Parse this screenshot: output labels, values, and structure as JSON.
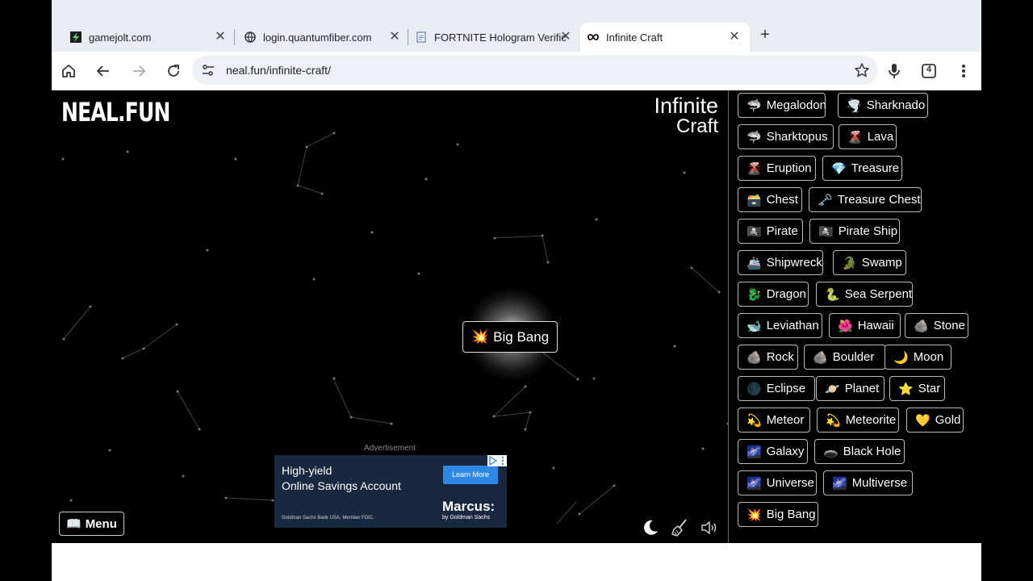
{
  "tabs": [
    {
      "title": "gamejolt.com",
      "favicon": "gamejolt-icon",
      "active": false
    },
    {
      "title": "login.quantumfiber.com",
      "favicon": "globe-icon",
      "active": false
    },
    {
      "title": "FORTNITE Hologram Verific",
      "favicon": "document-icon",
      "active": false
    },
    {
      "title": "Infinite Craft",
      "favicon": "infinity-icon",
      "active": true
    }
  ],
  "toolbar": {
    "url": "neal.fun/infinite-craft/",
    "extensions_count": "4"
  },
  "game": {
    "logo": "NEAL.FUN",
    "title_line1": "Infinite",
    "title_line2": "Craft",
    "canvas_element": {
      "emoji": "💥",
      "label": "Big Bang"
    },
    "menu_label": "Menu",
    "menu_emoji": "📖"
  },
  "ad": {
    "label": "Advertisement",
    "headline_line1": "High-yield",
    "headline_line2": "Online Savings Account",
    "cta": "Learn More",
    "brand": "Marcus:",
    "brand_sub": "by Goldman Sachs",
    "legal": "Goldman Sachs Bank USA. Member FDIC."
  },
  "sidebar": {
    "items": [
      {
        "emoji": "🦈",
        "label": "Megalodon"
      },
      {
        "emoji": "🌪️",
        "label": "Sharknado"
      },
      {
        "emoji": "🦈",
        "label": "Sharktopus"
      },
      {
        "emoji": "🌋",
        "label": "Lava"
      },
      {
        "emoji": "🌋",
        "label": "Eruption"
      },
      {
        "emoji": "💎",
        "label": "Treasure"
      },
      {
        "emoji": "🗃️",
        "label": "Chest"
      },
      {
        "emoji": "🗝️",
        "label": "Treasure Chest"
      },
      {
        "emoji": "🏴‍☠️",
        "label": "Pirate"
      },
      {
        "emoji": "🏴‍☠️",
        "label": "Pirate Ship"
      },
      {
        "emoji": "🚢",
        "label": "Shipwreck"
      },
      {
        "emoji": "🐊",
        "label": "Swamp"
      },
      {
        "emoji": "🐉",
        "label": "Dragon"
      },
      {
        "emoji": "🐍",
        "label": "Sea Serpent"
      },
      {
        "emoji": "🐋",
        "label": "Leviathan"
      },
      {
        "emoji": "🌺",
        "label": "Hawaii"
      },
      {
        "emoji": "🪨",
        "label": "Stone"
      },
      {
        "emoji": "🪨",
        "label": "Rock"
      },
      {
        "emoji": "🪨",
        "label": "Boulder"
      },
      {
        "emoji": "🌙",
        "label": "Moon"
      },
      {
        "emoji": "🌑",
        "label": "Eclipse"
      },
      {
        "emoji": "🪐",
        "label": "Planet"
      },
      {
        "emoji": "⭐",
        "label": "Star"
      },
      {
        "emoji": "💫",
        "label": "Meteor"
      },
      {
        "emoji": "💫",
        "label": "Meteorite"
      },
      {
        "emoji": "💛",
        "label": "Gold"
      },
      {
        "emoji": "🌌",
        "label": "Galaxy"
      },
      {
        "emoji": "🕳️",
        "label": "Black Hole"
      },
      {
        "emoji": "🌌",
        "label": "Universe"
      },
      {
        "emoji": "🌌",
        "label": "Multiverse"
      },
      {
        "emoji": "💥",
        "label": "Big Bang"
      }
    ]
  },
  "icons": {
    "home": "home-icon",
    "back": "back-icon",
    "forward": "forward-icon",
    "reload": "reload-icon",
    "site_settings": "tune-icon",
    "bookmark": "star-icon",
    "voice": "mic-icon",
    "menu": "kebab-icon",
    "dark_mode": "moon-icon",
    "clear": "broom-icon",
    "sound": "speaker-icon"
  },
  "colors": {
    "tabstrip": "#e9edf2",
    "omnibox": "#eef1f5",
    "game_bg": "#000000",
    "ad_bg": "#192740",
    "ad_cta": "#2d89e5"
  }
}
